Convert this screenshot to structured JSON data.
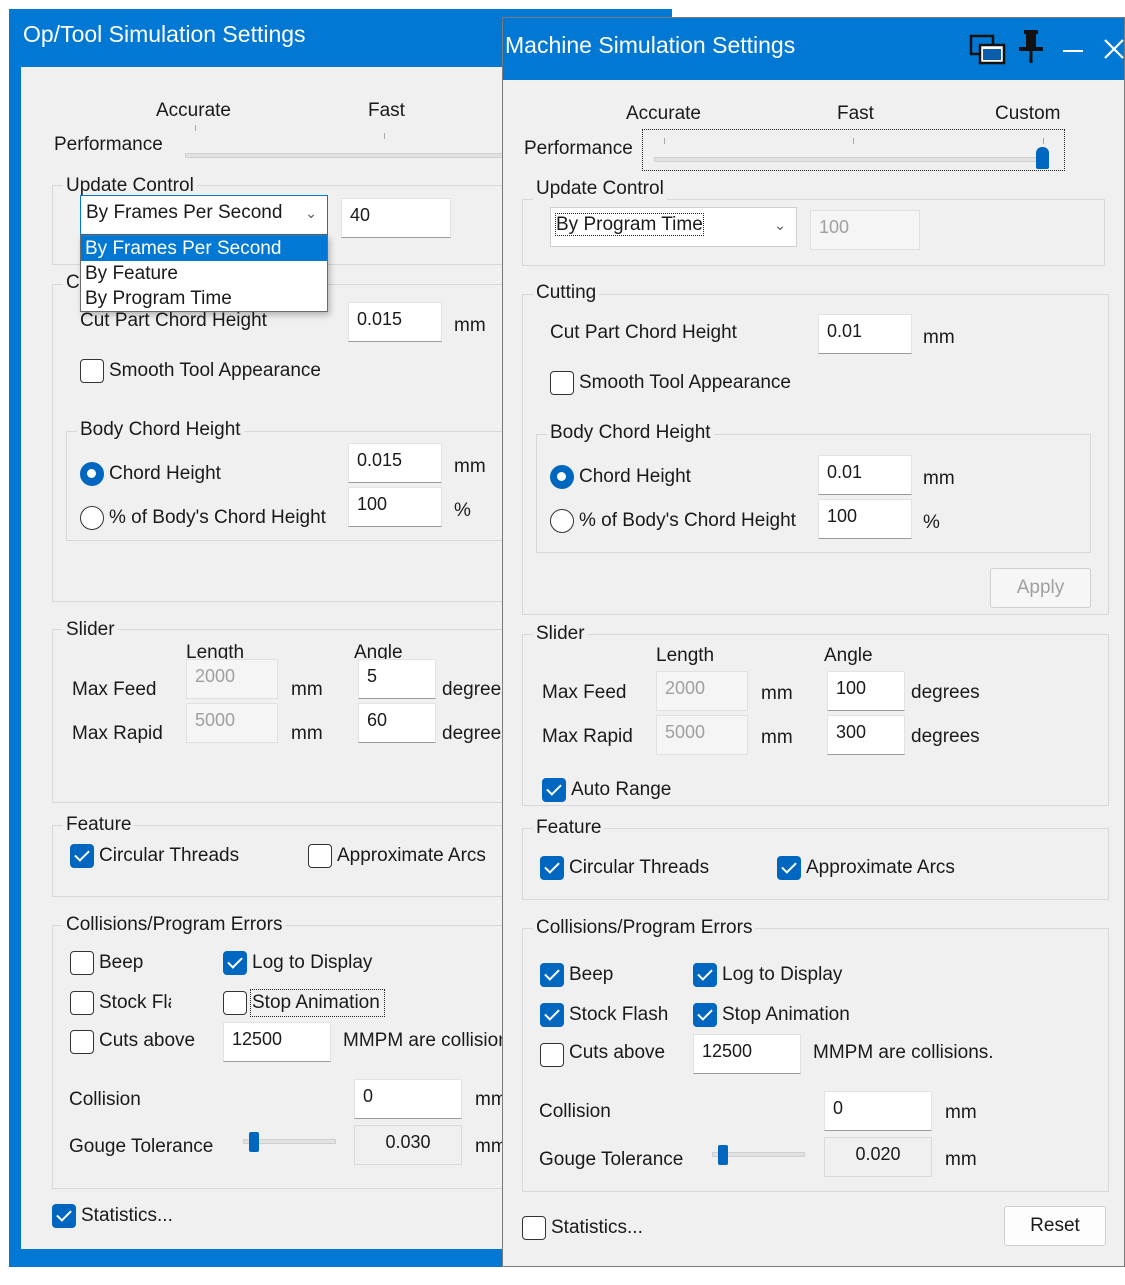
{
  "colors": {
    "titlebar": "#0078d4",
    "accent": "#0067c0",
    "window_bg": "#f0f0f0"
  },
  "op_tool": {
    "title": "Op/Tool Simulation Settings",
    "performance": {
      "label": "Performance",
      "levels": [
        "Accurate",
        "Fast"
      ]
    },
    "update_control": {
      "title": "Update Control",
      "mode": "By Frames Per Second",
      "value": "40",
      "options": [
        "By Frames Per Second",
        "By Feature",
        "By Program Time"
      ]
    },
    "cutting": {
      "title_partial": "C",
      "cut_chord_label": "Cut Part Chord Height",
      "cut_chord_value": "0.015",
      "unit": "mm",
      "smooth_label": "Smooth Tool Appearance",
      "smooth_checked": false,
      "body": {
        "title": "Body Chord Height",
        "chord_label": "Chord Height",
        "chord_value": "0.015",
        "chord_unit": "mm",
        "pct_label": "% of Body's Chord Height",
        "pct_value": "100",
        "pct_unit": "%",
        "selected": "chord"
      }
    },
    "slider": {
      "title": "Slider",
      "length_header": "Length",
      "angle_header": "Angle",
      "max_feed_label": "Max Feed",
      "max_feed_length": "2000",
      "max_feed_angle": "5",
      "max_rapid_label": "Max Rapid",
      "max_rapid_length": "5000",
      "max_rapid_angle": "60",
      "length_unit": "mm",
      "angle_unit": "degrees"
    },
    "feature": {
      "title": "Feature",
      "circular_label": "Circular Threads",
      "circular_checked": true,
      "arcs_label": "Approximate Arcs",
      "arcs_checked": false
    },
    "collisions": {
      "title": "Collisions/Program Errors",
      "beep_label": "Beep",
      "beep_checked": false,
      "log_label": "Log to Display",
      "log_checked": true,
      "flash_label": "Stock Flash",
      "flash_checked": false,
      "stop_label": "Stop Animation",
      "stop_checked": false,
      "cuts_label": "Cuts above",
      "cuts_checked": false,
      "cuts_value": "12500",
      "cuts_suffix": "MMPM are collisions.",
      "collision_label": "Collision",
      "collision_value": "0",
      "collision_unit": "mm",
      "gouge_label": "Gouge Tolerance",
      "gouge_value": "0.030",
      "gouge_unit": "mm"
    },
    "statistics": {
      "label": "Statistics...",
      "checked": true
    }
  },
  "machine": {
    "title": "Machine Simulation Settings",
    "icons": [
      "window-icon",
      "pin-icon",
      "minimize-icon",
      "close-icon"
    ],
    "performance": {
      "label": "Performance",
      "levels": [
        "Accurate",
        "Fast",
        "Custom"
      ],
      "setting": "Custom"
    },
    "update_control": {
      "title": "Update Control",
      "mode": "By Program Time",
      "value": "100"
    },
    "cutting": {
      "title": "Cutting",
      "cut_chord_label": "Cut Part Chord Height",
      "cut_chord_value": "0.01",
      "unit": "mm",
      "smooth_label": "Smooth Tool Appearance",
      "smooth_checked": false,
      "body": {
        "title": "Body Chord Height",
        "chord_label": "Chord Height",
        "chord_value": "0.01",
        "chord_unit": "mm",
        "pct_label": "% of Body's Chord Height",
        "pct_value": "100",
        "pct_unit": "%",
        "selected": "chord"
      },
      "apply_label": "Apply"
    },
    "slider": {
      "title": "Slider",
      "length_header": "Length",
      "angle_header": "Angle",
      "max_feed_label": "Max Feed",
      "max_feed_length": "2000",
      "max_feed_angle": "100",
      "max_rapid_label": "Max Rapid",
      "max_rapid_length": "5000",
      "max_rapid_angle": "300",
      "length_unit": "mm",
      "angle_unit": "degrees",
      "auto_range_label": "Auto Range",
      "auto_range_checked": true
    },
    "feature": {
      "title": "Feature",
      "circular_label": "Circular Threads",
      "circular_checked": true,
      "arcs_label": "Approximate Arcs",
      "arcs_checked": true
    },
    "collisions": {
      "title": "Collisions/Program Errors",
      "beep_label": "Beep",
      "beep_checked": true,
      "log_label": "Log to Display",
      "log_checked": true,
      "flash_label": "Stock Flash",
      "flash_checked": true,
      "stop_label": "Stop Animation",
      "stop_checked": true,
      "cuts_label": "Cuts above",
      "cuts_checked": false,
      "cuts_value": "12500",
      "cuts_suffix": "MMPM are collisions.",
      "collision_label": "Collision",
      "collision_value": "0",
      "collision_unit": "mm",
      "gouge_label": "Gouge Tolerance",
      "gouge_value": "0.020",
      "gouge_unit": "mm"
    },
    "statistics": {
      "label": "Statistics...",
      "checked": false
    },
    "reset_label": "Reset"
  }
}
